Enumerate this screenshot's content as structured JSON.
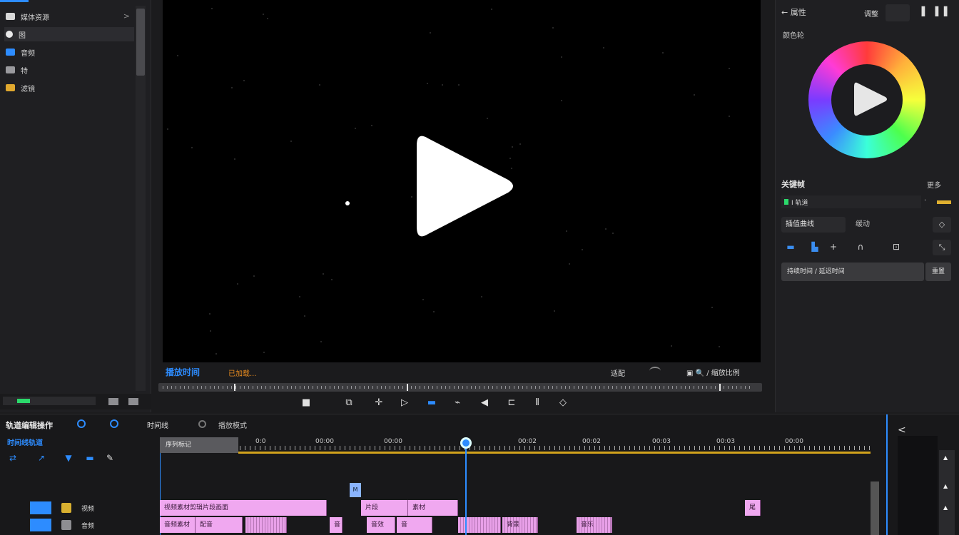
{
  "left_panel": {
    "items": [
      {
        "label": "媒体资源",
        "icon": "media-icon",
        "has_chevron": true
      },
      {
        "label": "图",
        "icon": "image-icon",
        "has_chevron": false
      },
      {
        "label": "音频",
        "icon": "audio-icon",
        "has_chevron": false
      },
      {
        "label": "特",
        "icon": "effect-icon",
        "has_chevron": false
      },
      {
        "label": "滤镜",
        "icon": "filter-icon",
        "has_chevron": false
      }
    ],
    "chevron": ">"
  },
  "preview": {
    "timecode": "播放时间",
    "status": "已加载...",
    "quality": "适配",
    "ratio": "▣ 🔍 / 缩放比例"
  },
  "transport": {
    "buttons": [
      "■",
      "⧉",
      "✛",
      "▷",
      "▬",
      "⌁",
      "◀",
      "⊏",
      "⫴",
      "◇"
    ]
  },
  "right_panel": {
    "back_label": "← 属性",
    "tab_label": "调整",
    "header_icons": "▐ ▐▐",
    "section_label": "颜色轮",
    "section2_title": "关键帧",
    "section2_right": "更多",
    "track_label": "I 轨道",
    "track_dot": "·",
    "btn_a": "插值曲线",
    "btn_b": "缓动",
    "btn_c": "◇",
    "tool_box": "⤡",
    "slider_label": "持续时间 / 延迟时间",
    "slider_btn": "重置"
  },
  "timeline": {
    "title": "轨道编辑操作",
    "subtitle": "时间线轨道",
    "tab_a": "时间线",
    "tab_b": "播放模式",
    "ruler_label": "序列标记",
    "ruler_labels": [
      "0:0",
      "00:00",
      "00:00",
      "00:02",
      "00:02",
      "00:03",
      "00:03",
      "00:00"
    ],
    "marker_label": "M",
    "tracks": [
      {
        "label": "视频",
        "clips": [
          {
            "label": "视频素材剪辑片段画面",
            "kind": "solid"
          },
          {
            "label": "片段",
            "kind": "solid"
          },
          {
            "label": "素材",
            "kind": "solid"
          },
          {
            "label": "尾",
            "kind": "solid"
          }
        ]
      },
      {
        "label": "音频",
        "clips": [
          {
            "label": "音频素材",
            "kind": "solid"
          },
          {
            "label": "配音",
            "kind": "solid"
          },
          {
            "label": "",
            "kind": "wave"
          },
          {
            "label": "音",
            "kind": "solid"
          },
          {
            "label": "音效",
            "kind": "solid"
          },
          {
            "label": "音",
            "kind": "solid"
          },
          {
            "label": "",
            "kind": "wave"
          },
          {
            "label": "背景",
            "kind": "wave"
          },
          {
            "label": "音乐",
            "kind": "wave"
          }
        ]
      }
    ],
    "right_icon": "<"
  },
  "colors": {
    "accent": "#2d8cff",
    "clip_pink": "#f0a8f0",
    "ruler_yellow": "#d2a31c",
    "status_orange": "#e58a1f"
  }
}
